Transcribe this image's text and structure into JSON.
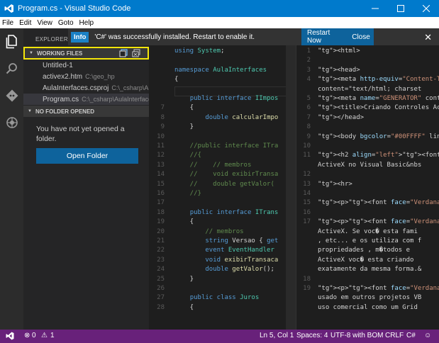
{
  "window": {
    "title": "Program.cs - Visual Studio Code",
    "app_icon": "vscode-icon",
    "controls": [
      "minimize-icon",
      "maximize-icon",
      "close-icon"
    ]
  },
  "menu": [
    "File",
    "Edit",
    "View",
    "Goto",
    "Help"
  ],
  "activity_bar": [
    "files-icon",
    "search-icon",
    "git-icon",
    "debug-icon"
  ],
  "sidebar": {
    "title": "EXPLORER",
    "working_files": {
      "header": "WORKING FILES",
      "actions": [
        "save-all-icon",
        "close-all-icon"
      ],
      "files": [
        {
          "name": "Untitled-1",
          "path": ""
        },
        {
          "name": "activex2.htm",
          "path": "C:\\geo_hp"
        },
        {
          "name": "AulaInterfaces.csproj",
          "path": "C:\\_csharp\\Au..."
        },
        {
          "name": "Program.cs",
          "path": "C:\\_csharp\\AulaInterfaces..."
        }
      ]
    },
    "no_folder": {
      "header": "NO FOLDER OPENED",
      "message": "You have not yet opened a folder.",
      "button": "Open Folder"
    }
  },
  "notification": {
    "badge": "Info",
    "message": "'C#' was successfully installed. Restart to enable it.",
    "restart_label": "Restart Now",
    "close_label": "Close",
    "dismiss_icon": "close-icon"
  },
  "editor_left": {
    "lines": [
      {
        "n": "",
        "t": "using System;"
      },
      {
        "n": "",
        "t": ""
      },
      {
        "n": "",
        "t": "namespace AulaInterfaces"
      },
      {
        "n": "",
        "t": "{"
      },
      {
        "n": "",
        "t": ""
      },
      {
        "n": "",
        "t": "    public interface IImpos"
      },
      {
        "n": "7",
        "t": "    {"
      },
      {
        "n": "8",
        "t": "        double calcularImpo"
      },
      {
        "n": "9",
        "t": "    }"
      },
      {
        "n": "10",
        "t": ""
      },
      {
        "n": "11",
        "t": "    //public interface ITra"
      },
      {
        "n": "12",
        "t": "    //{"
      },
      {
        "n": "13",
        "t": "    //    // membros"
      },
      {
        "n": "14",
        "t": "    //    void exibirTransa"
      },
      {
        "n": "15",
        "t": "    //    double getValor("
      },
      {
        "n": "16",
        "t": "    //}"
      },
      {
        "n": "17",
        "t": ""
      },
      {
        "n": "18",
        "t": "    public interface ITrans"
      },
      {
        "n": "19",
        "t": "    {"
      },
      {
        "n": "20",
        "t": "        // membros"
      },
      {
        "n": "21",
        "t": "        string Versao { get"
      },
      {
        "n": "22",
        "t": "        event EventHandler"
      },
      {
        "n": "23",
        "t": "        void exibirTransaca"
      },
      {
        "n": "24",
        "t": "        double getValor();"
      },
      {
        "n": "25",
        "t": "    }"
      },
      {
        "n": "26",
        "t": ""
      },
      {
        "n": "27",
        "t": "    public class Juros"
      },
      {
        "n": "28",
        "t": "    {"
      }
    ]
  },
  "editor_right": {
    "lines": [
      {
        "n": "1",
        "t": "<html>"
      },
      {
        "n": "2",
        "t": ""
      },
      {
        "n": "3",
        "t": "<head>"
      },
      {
        "n": "4",
        "t": "<meta http-equiv=\"Content-T"
      },
      {
        "n": "",
        "t": "content=\"text/html; charset"
      },
      {
        "n": "5",
        "t": "<meta name=\"GENERATOR\" cont"
      },
      {
        "n": "6",
        "t": "<title>Criando Controles Ac"
      },
      {
        "n": "7",
        "t": "</head>"
      },
      {
        "n": "8",
        "t": ""
      },
      {
        "n": "9",
        "t": "<body bgcolor=\"#00FFFF\" lin"
      },
      {
        "n": "10",
        "t": ""
      },
      {
        "n": "11",
        "t": "<h2 align=\"left\"><font colo"
      },
      {
        "n": "",
        "t": "ActiveX no Visual Basic&nbs"
      },
      {
        "n": "12",
        "t": ""
      },
      {
        "n": "13",
        "t": "<hr>"
      },
      {
        "n": "14",
        "t": ""
      },
      {
        "n": "15",
        "t": "<p><font face=\"Verdana\" siz"
      },
      {
        "n": "16",
        "t": ""
      },
      {
        "n": "17",
        "t": "<p><font face=\"Verdana\" siz"
      },
      {
        "n": "",
        "t": "ActiveX. Se voc� esta fami"
      },
      {
        "n": "",
        "t": ", etc... e os utiliza com f"
      },
      {
        "n": "",
        "t": "propriedades , m�todos e"
      },
      {
        "n": "",
        "t": "ActiveX voc� esta criando"
      },
      {
        "n": "",
        "t": "exatamente da mesma forma.&"
      },
      {
        "n": "18",
        "t": ""
      },
      {
        "n": "19",
        "t": "<p><font face=\"Verdana\" siz"
      },
      {
        "n": "",
        "t": "usado em outros projetos VB"
      },
      {
        "n": "",
        "t": "uso comercial como um Grid"
      }
    ]
  },
  "status_bar": {
    "errors": "0",
    "warnings": "1",
    "position": "Ln 5, Col 1",
    "spaces": "Spaces: 4",
    "encoding": "UTF-8 with BOM",
    "eol": "CRLF",
    "language": "C#"
  },
  "colors": {
    "titlebar": "#007acc",
    "statusbar": "#68217a",
    "annotation": "#f5e60a",
    "button": "#0e639c"
  }
}
